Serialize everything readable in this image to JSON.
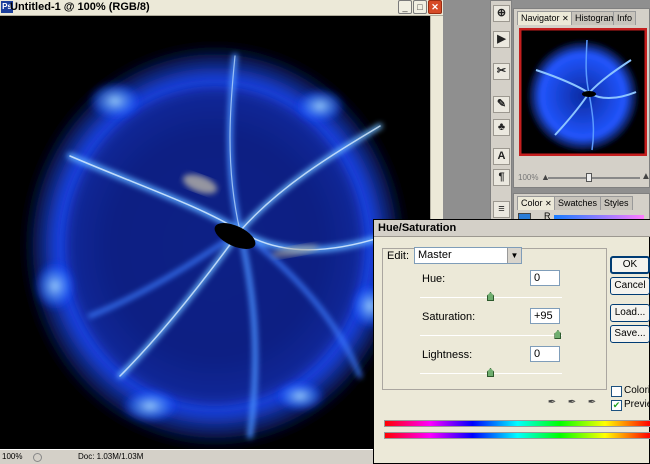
{
  "document": {
    "title": "Untitled-1 @ 100% (RGB/8)",
    "zoom": "100%",
    "doc_info": "Doc: 1.03M/1.03M"
  },
  "tools": [
    {
      "name": "move-tool-icon",
      "glyph": "⊕"
    },
    {
      "name": "screen-mode-icon",
      "glyph": "▶"
    },
    {
      "name": "crop-tool-icon",
      "glyph": "✂"
    },
    {
      "name": "brush-tool-icon",
      "glyph": "✎"
    },
    {
      "name": "stamp-tool-icon",
      "glyph": "♣"
    },
    {
      "name": "type-tool-icon",
      "glyph": "A"
    },
    {
      "name": "paragraph-icon",
      "glyph": "¶"
    },
    {
      "name": "notes-tool-icon",
      "glyph": "≡"
    }
  ],
  "navigator": {
    "tabs": [
      "Navigator",
      "Histogram",
      "Info"
    ],
    "zoom": "100%"
  },
  "color_panel": {
    "tabs": [
      "Color",
      "Swatches",
      "Styles"
    ],
    "channel": "R"
  },
  "dialog": {
    "title": "Hue/Saturation",
    "edit_label": "Edit:",
    "edit_value": "Master",
    "hue_label": "Hue:",
    "hue_value": "0",
    "saturation_label": "Saturation:",
    "saturation_value": "+95",
    "lightness_label": "Lightness:",
    "lightness_value": "0",
    "hue_level": 0.5,
    "saturation_level": 0.975,
    "lightness_level": 0.5,
    "ok_label": "OK",
    "cancel_label": "Cancel",
    "load_label": "Load...",
    "save_label": "Save...",
    "colorize_label": "Colorize",
    "preview_label": "Preview",
    "colorize_checked": false,
    "preview_checked": true
  },
  "colors": {
    "glow_blue": "#1a5cff",
    "deep_blue": "#0a1f9c",
    "dialog_bg": "#ece9d8",
    "close_red": "#d64a26"
  }
}
